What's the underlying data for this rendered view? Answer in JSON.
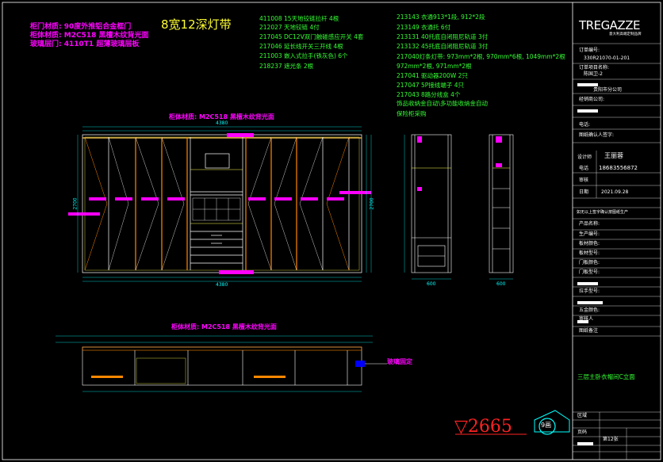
{
  "title": "8宽12深灯带",
  "material_notes": [
    "柜门材质: 90度外推铝合金框门",
    "柜体材质: M2C518 黑檀木纹背光面",
    "玻璃层门: 4110T1 超薄玻璃层板"
  ],
  "cabinet_material_label": "柜体材质: M2C518 黑檀木纹背光面",
  "cabinet_material_label_lower": "柜体材质: M2C518 黑檀木纹背光面",
  "parts_list_left": [
    "411008  15天地铰链拉杆   4根",
    "212027  天地铰链        4付",
    "217045  DC12V双门触碰感应开关  4套",
    "217046  延长线开关三开线  4根",
    "211003  嵌入式拉手(铁灰色)  6个",
    "218237  遮光条   2根"
  ],
  "parts_list_right": [
    "213143  衣通913*1段, 912*2段",
    "213149  衣通托   6付",
    "213131  40托底自闭阻尼轨道  3付",
    "213132  45托底自闭阻尼轨道  3付",
    "217040灯条灯带:  973mm*2根, 970mm*6根, 1049mm*2根",
    "972mm*2根,  971mm*2根",
    "217041  驱动器200W  2只",
    "217047  5P接线端子  4只",
    "217043  8路分线盒   4个",
    "饰品收纳金自动\\多功能收纳金自动",
    "保险柜采购"
  ],
  "annotation_right": "玻璃固定",
  "elevation_label": "▽2665",
  "section_marker": "9画",
  "dimensions": {
    "top_overall": "4380",
    "bottom_overall": "4380",
    "left_height": "2700",
    "right_height": "2700",
    "bottom_row": [
      "600",
      "600",
      "600",
      "500",
      "900",
      "500",
      "600",
      "600",
      "600"
    ],
    "top_row": [
      "600",
      "600",
      "600",
      "500",
      "900",
      "500",
      "600",
      "600",
      "600"
    ],
    "side_a_width": "600",
    "side_b_width": "600",
    "plan_widths": [
      "1200",
      "900",
      "600",
      "900",
      "600",
      "1200"
    ]
  },
  "title_block": {
    "logo": "TREGAZZE",
    "logo_sub": "意大利高端定制品牌",
    "order_no_label": "订单编号:",
    "order_no": "330R21070-01-201",
    "drawing_no_label": "订单项目名称:",
    "drawing_no": "陈国卫-2",
    "dealer": "经销商公司:",
    "dealer_value": "贵阳市分公司",
    "address_label": "订货地址:",
    "phone_label": "电话:",
    "owner_label": "图纸确认人签字:",
    "designer_label": "设计师",
    "designer": "王丽蓉",
    "tel_label": "电话",
    "tel": "18683556872",
    "review_label": "审核",
    "date_label": "日期",
    "date": "2021.09.28",
    "notice": "如无以上签字确认按图纸生产",
    "rows": [
      "产品名称:",
      "生产编号:",
      "板材颜色:",
      "板材型号:",
      "门板颜色:",
      "门板型号:",
      "拉手型号:",
      "五金颜色:",
      "见门配件:",
      "铝门型号:",
      "其他:"
    ],
    "sign_label": "审核人",
    "room_label": "图纸备注",
    "room_value": "三层主卧衣帽间C立面",
    "area_label": "区域",
    "page_label": "页码",
    "page_value": "第12张"
  }
}
